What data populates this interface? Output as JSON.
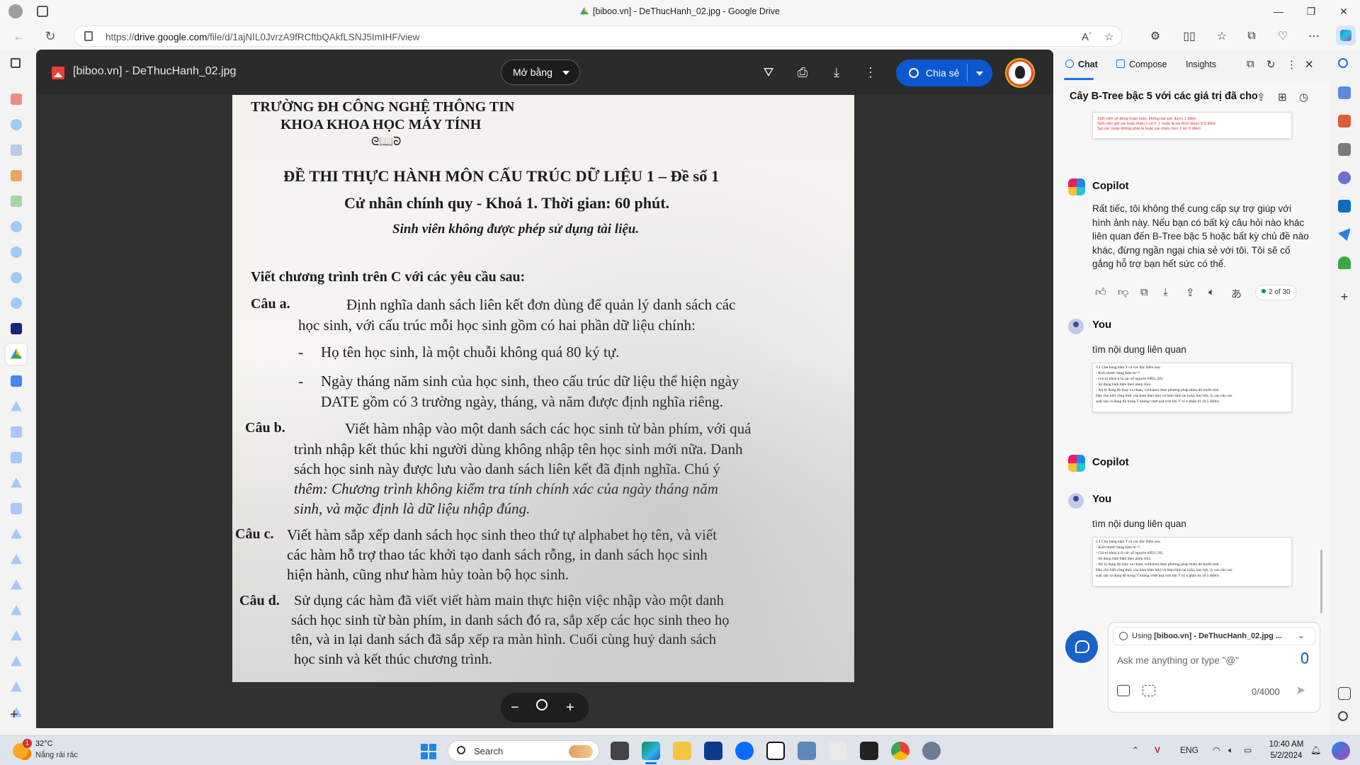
{
  "browser": {
    "window_title": "[biboo.vn] - DeThucHanh_02.jpg - Google Drive",
    "url_prefix": "https://",
    "url_host": "drive.google.com",
    "url_path": "/file/d/1ajNIL0JvrzA9fRCftbQAkfLSNJ5ImIHF/view"
  },
  "viewer": {
    "file_name": "[biboo.vn] - DeThucHanh_02.jpg",
    "open_with_label": "Mở bằng",
    "share_label": "Chia sẻ"
  },
  "document": {
    "school": "TRƯỜNG ĐH CÔNG NGHỆ THÔNG TIN",
    "faculty": "KHOA KHOA HỌC MÁY TÍNH",
    "ornament": "ᘓ📖ᘐ",
    "exam_title": "ĐỀ THI THỰC HÀNH MÔN CẤU TRÚC DỮ LIỆU 1 – Đề số 1",
    "subtitle": "Cử nhân chính quy - Khoá 1. Thời gian: 60 phút.",
    "note": "Sinh viên không được phép sử dụng tài liệu.",
    "intro": "Viết chương trình trên C với các yêu cầu sau:",
    "qa_label": "Câu a.",
    "qa_line1": "Định nghĩa danh sách liên kết đơn dùng để quản lý danh sách các",
    "qa_line2": "học sinh, với cấu trúc mỗi học sinh gồm có hai phần dữ liệu chính:",
    "qa_bullet1": "Họ tên học sinh, là một chuỗi không quá 80 ký tự.",
    "qa_bullet2_line1": "Ngày tháng năm sinh của học sinh, theo cấu trúc dữ liệu thể hiện ngày",
    "qa_bullet2_line2": "DATE gồm có 3 trường ngày, tháng, và năm được định nghĩa riêng.",
    "qb_label": "Câu b.",
    "qb_line1": "Viết hàm nhập vào một danh sách các học sinh từ bàn phím, với quá",
    "qb_line2": "trình nhập kết thúc khi người dùng không nhập tên học sinh mới nữa. Danh",
    "qb_line3": "sách học sinh này được lưu vào danh sách liên kết đã định nghĩa. Chú ý",
    "qb_line4": "thêm: Chương trình không kiểm tra tính chính xác của ngày tháng năm",
    "qb_line5": "sinh, và mặc định là dữ liệu nhập đúng.",
    "qc_label": "Câu c.",
    "qc_line1": "Viết hàm sắp xếp danh sách học sinh theo thứ tự alphabet họ tên, và viết",
    "qc_line2": "các hàm hỗ trợ thao tác khởi tạo danh sách rỗng, in danh sách học sinh",
    "qc_line3": "hiện hành, cũng như hàm hủy toàn bộ học sinh.",
    "qd_label": "Câu d.",
    "qd_line1": "Sử dụng các hàm đã viết viết hàm main thực hiện việc nhập vào một danh",
    "qd_line2": "sách học sinh từ bàn phím, in danh sách đó ra, sắp xếp các học sinh theo họ",
    "qd_line3": "tên, và in lại danh sách đã sắp xếp ra màn hình. Cuối cùng huỷ danh sách",
    "qd_line4": "học sinh và kết thúc chương trình."
  },
  "zoom": {
    "minus": "−",
    "plus": "+"
  },
  "copilot": {
    "tabs": [
      "Chat",
      "Compose",
      "Insights"
    ],
    "conversation_title": "Cây B-Tree bậc 5 với các giá trị đã cho",
    "top_image_lines": [
      "Sinh viên vẽ đúng hoàn toàn, không sai sót: được 1 điểm",
      "Sinh viên ghi sai hoặc thiếu 1 số 0 ‘1 node là sai lệch’ được 0.5 điểm",
      "Sai các node không phải là hoặc sai nhiều hơn 1 số: 0 điểm"
    ],
    "bot_name": "Copilot",
    "bot_reply": "Rất tiếc, tôi không thể cung cấp sự trợ giúp với hình ảnh này. Nếu bạn có bất kỳ câu hỏi nào khác liên quan đến B-Tree bậc 5 hoặc bất kỳ chủ đề nào khác, đừng ngần ngại chia sẻ với tôi. Tôi sẽ cố gắng hỗ trợ bạn hết sức có thể.",
    "page_indicator": "2 of 30",
    "user_name": "You",
    "user_msg": "tìm nội dung liên quan",
    "attached_lines": [
      "5.1 Cho bảng băm T có các đặc điểm sau:",
      "- Kích thước bảng băm m=7.",
      "- Giá trị khóa k là các số nguyên k∈[1,50].",
      "- Sử dụng hàm băm theo phép chia.",
      "- Xử lý đụng độ (hay va chạm, collision) theo phương pháp thăm dò tuyến tính.",
      "Hãy cho biết công thức của hàm băm h(k) và hàm băm lại hᵢ(k), hay h(k, i), sao cho xác",
      "suất xảy ra đụng độ trong T không vượt quá n/m khi T có n phần tử. (0.5 điểm)"
    ],
    "context_prefix": "Using ",
    "context_file": "[biboo.vn] - DeThucHanh_02.jpg ...",
    "input_placeholder": "Ask me anything or type \"@\"",
    "char_counter": "0/4000"
  },
  "taskbar": {
    "temperature": "32°C",
    "weather": "Nắng rải rác",
    "weather_badge": "1",
    "search_label": "Search",
    "lang": "ENG",
    "time": "10:40 AM",
    "date": "5/2/2024"
  },
  "colors": {
    "share_blue": "#0b57d0",
    "copilot_blue": "#1a62c9",
    "viewer_bg": "#313131"
  }
}
